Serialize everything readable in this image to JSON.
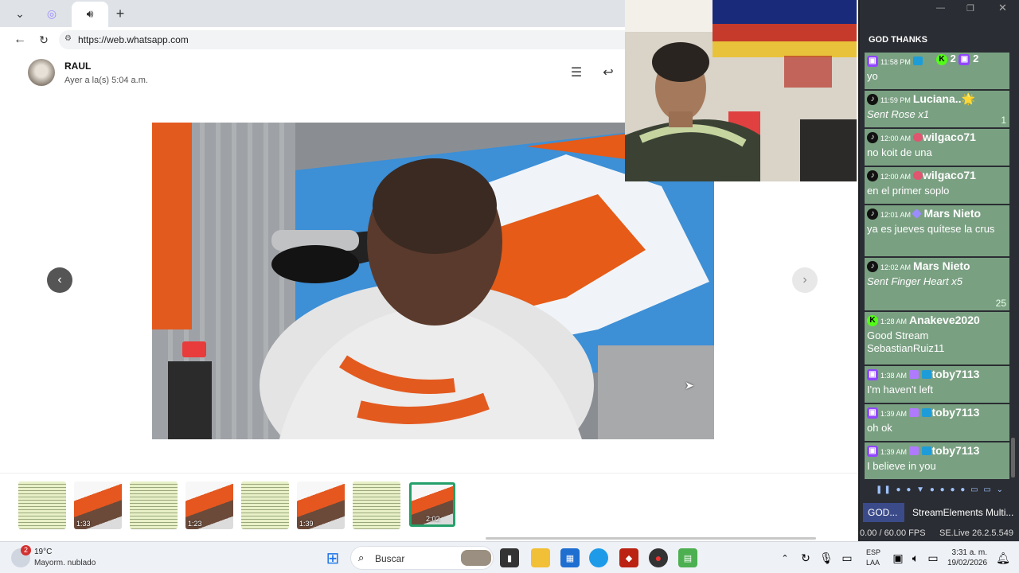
{
  "browser": {
    "url": "https://web.whatsapp.com"
  },
  "message": {
    "contact_name": "RAUL",
    "timestamp": "Ayer a la(s) 5:04 a.m."
  },
  "thumbnails": [
    {
      "kind": "document",
      "duration": ""
    },
    {
      "kind": "video",
      "duration": "1:33"
    },
    {
      "kind": "document",
      "duration": ""
    },
    {
      "kind": "video",
      "duration": "1:23"
    },
    {
      "kind": "document",
      "duration": ""
    },
    {
      "kind": "video",
      "duration": "1:39"
    },
    {
      "kind": "document",
      "duration": ""
    },
    {
      "kind": "video",
      "duration": "2:02",
      "selected": true
    }
  ],
  "dock": {
    "title": "GOD THANKS",
    "viewers_kick": "2",
    "viewers_twitch": "2",
    "tab_god": "GOD...",
    "tab_se": "StreamElements Multi...",
    "fps": "0.00 / 60.00 FPS",
    "version": "SE.Live 26.2.5.549"
  },
  "chat": [
    {
      "platform": "twitch",
      "time": "11:58 PM",
      "user": "",
      "text": "yo",
      "amount": ""
    },
    {
      "platform": "tiktok",
      "time": "11:59 PM",
      "user": "Luciana..🌟",
      "text": "Sent Rose x1",
      "italic": true,
      "amount": "1"
    },
    {
      "platform": "tiktok",
      "time": "12:00 AM",
      "user": "wilgaco71",
      "text": "no koit de una",
      "amount": ""
    },
    {
      "platform": "tiktok",
      "time": "12:00 AM",
      "user": "wilgaco71",
      "text": "en el primer soplo",
      "amount": ""
    },
    {
      "platform": "tiktok",
      "time": "12:01 AM",
      "user": "Mars Nieto",
      "text": "ya es jueves quítese la crus",
      "amount": ""
    },
    {
      "platform": "tiktok",
      "time": "12:02 AM",
      "user": "Mars Nieto",
      "text": "Sent Finger Heart x5",
      "italic": true,
      "amount": "25"
    },
    {
      "platform": "kick",
      "time": "1:28 AM",
      "user": "Anakeve2020",
      "text": "Good Stream SebastianRuiz11",
      "amount": ""
    },
    {
      "platform": "twitch",
      "time": "1:38 AM",
      "user": "toby7113",
      "text": "I'm haven't left",
      "amount": ""
    },
    {
      "platform": "twitch",
      "time": "1:39 AM",
      "user": "toby7113",
      "text": "oh ok",
      "amount": ""
    },
    {
      "platform": "twitch",
      "time": "1:39 AM",
      "user": "toby7113",
      "text": "I believe in you",
      "amount": ""
    }
  ],
  "taskbar": {
    "weather_badge": "2",
    "temperature": "19°C",
    "weather": "Mayorm. nublado",
    "search_label": "Buscar",
    "lang_top": "ESP",
    "lang_bottom": "LAA",
    "time": "3:31 a. m.",
    "date": "19/02/2026"
  },
  "colors": {
    "chat_bg": "#7aa082",
    "whatsapp_green": "#25a06a",
    "twitch": "#9146ff",
    "kick": "#53fc18"
  }
}
